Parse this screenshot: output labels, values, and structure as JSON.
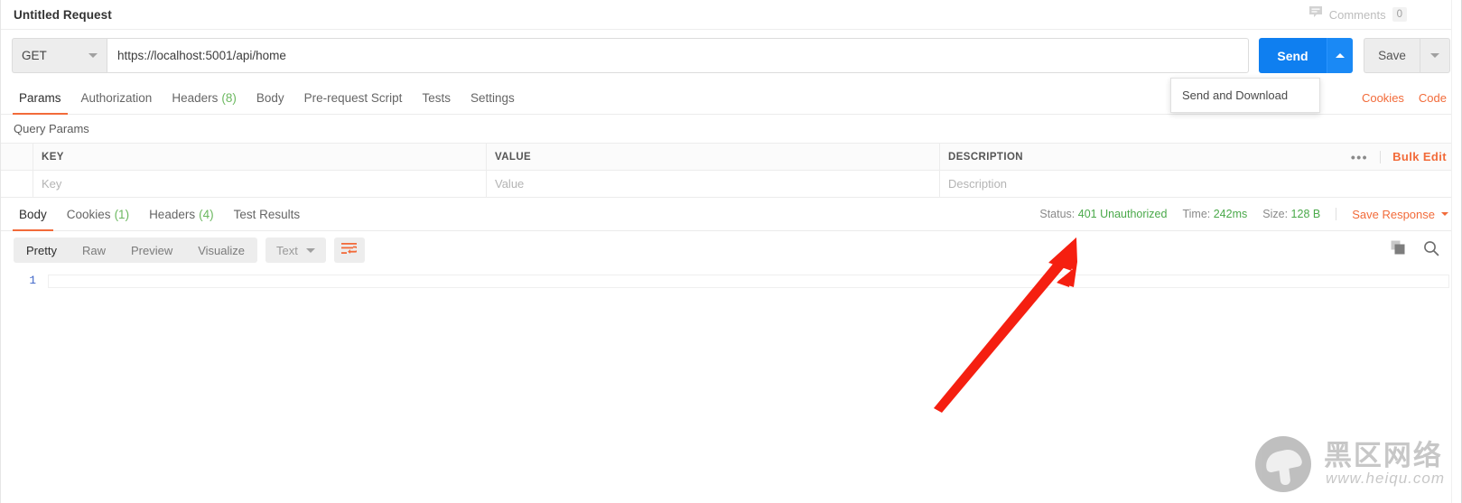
{
  "titlebar": {
    "request_name": "Untitled Request",
    "comments_icon": "comment-icon",
    "comments_label": "Comments",
    "comments_count": "0"
  },
  "url_row": {
    "method": "GET",
    "url": "https://localhost:5001/api/home",
    "send_label": "Send",
    "send_caret_icon": "chevron-up-icon",
    "save_label": "Save",
    "save_caret_icon": "chevron-down-icon",
    "send_menu_item": "Send and Download"
  },
  "request_tabs": {
    "items": [
      {
        "label": "Params",
        "count": "",
        "active": true
      },
      {
        "label": "Authorization",
        "count": "",
        "active": false
      },
      {
        "label": "Headers",
        "count": "(8)",
        "active": false
      },
      {
        "label": "Body",
        "count": "",
        "active": false
      },
      {
        "label": "Pre-request Script",
        "count": "",
        "active": false
      },
      {
        "label": "Tests",
        "count": "",
        "active": false
      },
      {
        "label": "Settings",
        "count": "",
        "active": false
      }
    ],
    "cookies_link": "Cookies",
    "code_link": "Code"
  },
  "query_params": {
    "section_label": "Query Params",
    "columns": [
      "KEY",
      "VALUE",
      "DESCRIPTION"
    ],
    "input_row": {
      "key_placeholder": "Key",
      "value_placeholder": "Value",
      "description_placeholder": "Description"
    },
    "more_icon": "ellipsis-icon",
    "bulk_edit_label": "Bulk Edit"
  },
  "response": {
    "tabs": [
      {
        "label": "Body",
        "count": "",
        "active": true
      },
      {
        "label": "Cookies",
        "count": "(1)",
        "active": false
      },
      {
        "label": "Headers",
        "count": "(4)",
        "active": false
      },
      {
        "label": "Test Results",
        "count": "",
        "active": false
      }
    ],
    "status_label": "Status:",
    "status_value": "401 Unauthorized",
    "time_label": "Time:",
    "time_value": "242ms",
    "size_label": "Size:",
    "size_value": "128 B",
    "save_response_label": "Save Response",
    "save_response_caret_icon": "chevron-down-icon",
    "status_color": "#4aa94a",
    "accent_color": "#f26b3a"
  },
  "response_toolbar": {
    "view_modes": [
      {
        "label": "Pretty",
        "active": true
      },
      {
        "label": "Raw",
        "active": false
      },
      {
        "label": "Preview",
        "active": false
      },
      {
        "label": "Visualize",
        "active": false
      }
    ],
    "format_label": "Text",
    "format_caret_icon": "chevron-down-icon",
    "wrap_icon": "word-wrap-icon",
    "copy_icon": "copy-icon",
    "search_icon": "search-icon"
  },
  "response_body": {
    "line_numbers": [
      "1"
    ],
    "content": ""
  },
  "annotation": {
    "arrow_icon": "red-arrow-icon",
    "arrow_color": "#f51f10"
  },
  "watermark": {
    "logo_icon": "mushroom-logo-icon",
    "brand_cn": "黑区网络",
    "brand_url": "www.heiqu.com"
  }
}
